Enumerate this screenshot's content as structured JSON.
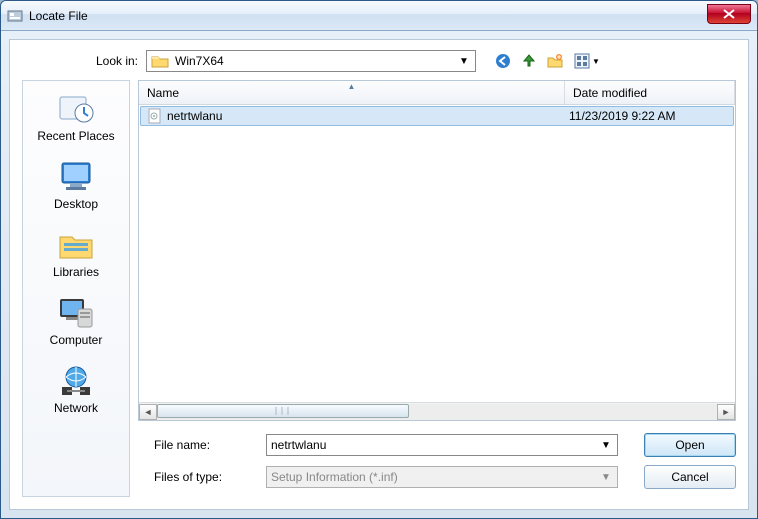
{
  "window": {
    "title": "Locate File"
  },
  "lookin": {
    "label": "Look in:",
    "value": "Win7X64"
  },
  "toolbar_icons": {
    "back": "back-icon",
    "up": "up-icon",
    "new_folder": "new-folder-icon",
    "views": "views-icon"
  },
  "places": [
    {
      "id": "recent",
      "label": "Recent Places"
    },
    {
      "id": "desktop",
      "label": "Desktop"
    },
    {
      "id": "libraries",
      "label": "Libraries"
    },
    {
      "id": "computer",
      "label": "Computer"
    },
    {
      "id": "network",
      "label": "Network"
    }
  ],
  "columns": {
    "name": "Name",
    "date": "Date modified"
  },
  "files": [
    {
      "name": "netrtwlanu",
      "date": "11/23/2019 9:22 AM",
      "selected": true
    }
  ],
  "filename": {
    "label": "File name:",
    "value": "netrtwlanu"
  },
  "filetype": {
    "label": "Files of type:",
    "value": "Setup Information (*.inf)"
  },
  "buttons": {
    "open": "Open",
    "cancel": "Cancel"
  }
}
